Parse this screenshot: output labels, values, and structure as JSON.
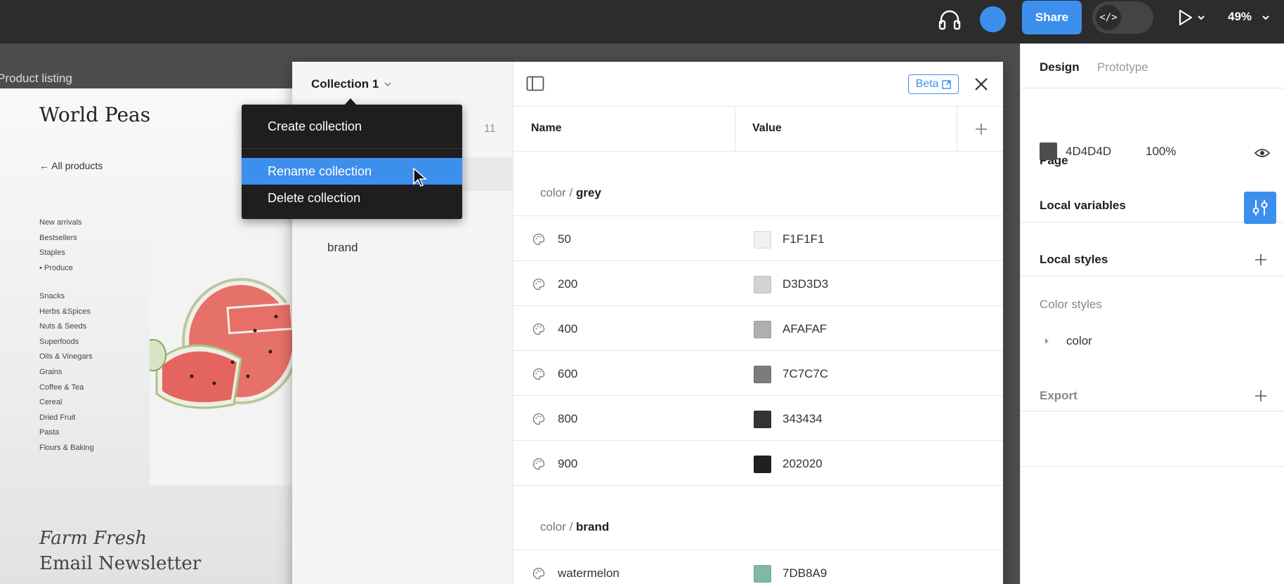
{
  "topbar": {
    "share_label": "Share",
    "dev_mode_symbol": "</>",
    "zoom": "49%",
    "icons": [
      "headphones-icon",
      "avatar",
      "play-icon",
      "chevron-down-icon"
    ]
  },
  "canvas": {
    "frame_label": "Product listing",
    "brand": "World Peas",
    "back_link": "← All products",
    "nav_primary": [
      "New arrivals",
      "Bestsellers",
      "Staples",
      "• Produce"
    ],
    "nav_secondary": [
      "Snacks",
      "Herbs &Spices",
      "Nuts & Seeds",
      "Superfoods",
      "Oils & Vinegars",
      "Grains",
      "Coffee & Tea",
      "Cereal",
      "Dried Fruit",
      "Pasta",
      "Flours & Baking"
    ],
    "headline_italic": "Farm Fresh",
    "headline": "Email Newsletter"
  },
  "modal": {
    "collection_title": "Collection 1",
    "group_count": "11",
    "groups": [
      "brand"
    ],
    "beta_label": "Beta",
    "columns": {
      "name": "Name",
      "value": "Value"
    },
    "sections": [
      {
        "prefix": "color / ",
        "name": "grey",
        "rows": [
          {
            "name": "50",
            "value": "F1F1F1",
            "swatch": "#F1F1F1"
          },
          {
            "name": "200",
            "value": "D3D3D3",
            "swatch": "#D3D3D3"
          },
          {
            "name": "400",
            "value": "AFAFAF",
            "swatch": "#AFAFAF"
          },
          {
            "name": "600",
            "value": "7C7C7C",
            "swatch": "#7C7C7C"
          },
          {
            "name": "800",
            "value": "343434",
            "swatch": "#343434"
          },
          {
            "name": "900",
            "value": "202020",
            "swatch": "#202020"
          }
        ]
      },
      {
        "prefix": "color / ",
        "name": "brand",
        "rows": [
          {
            "name": "watermelon",
            "value": "7DB8A9",
            "swatch": "#7DB8A9"
          }
        ]
      }
    ]
  },
  "dropdown": {
    "items": [
      {
        "label": "Create collection",
        "active": false
      },
      {
        "label": "Rename collection",
        "active": true
      },
      {
        "label": "Delete collection",
        "active": false
      }
    ]
  },
  "panel": {
    "tabs": {
      "design": "Design",
      "prototype": "Prototype"
    },
    "page_title": "Page",
    "page_color": "4D4D4D",
    "page_opacity": "100%",
    "local_variables": "Local variables",
    "local_styles": "Local styles",
    "color_styles": "Color styles",
    "color_group": "color",
    "export": "Export"
  },
  "colors": {
    "accent": "#3D8FEE",
    "topbar": "#2C2C2C",
    "canvas": "#4D4D4D"
  }
}
